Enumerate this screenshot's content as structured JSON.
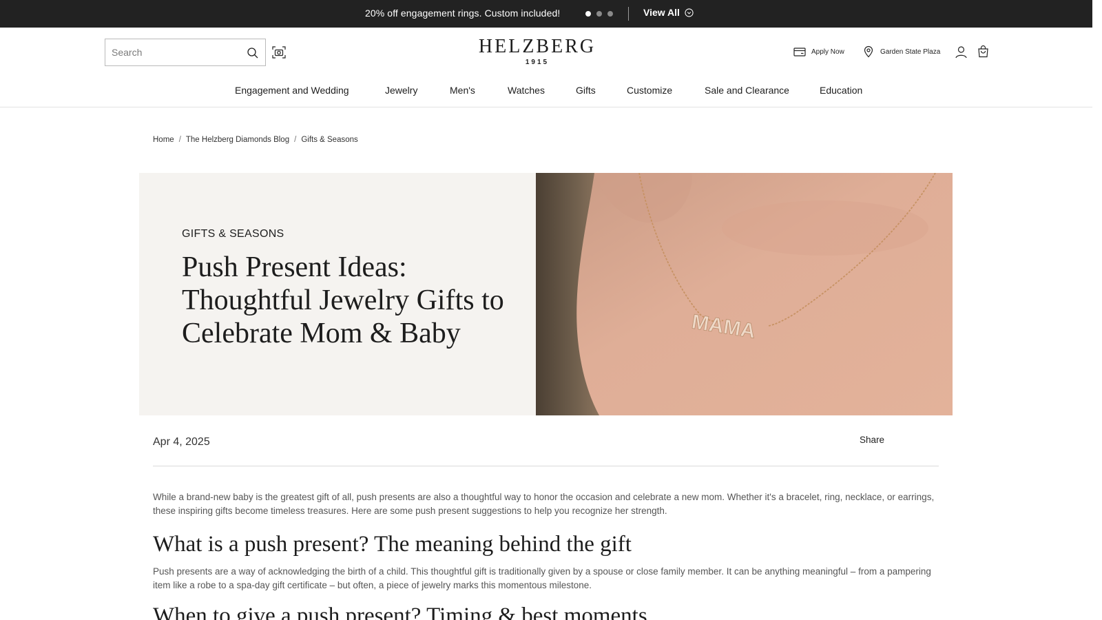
{
  "promo": {
    "text": "20% off engagement rings. Custom included!",
    "dots": [
      true,
      false,
      false
    ],
    "view_all_label": "View All"
  },
  "header": {
    "search_placeholder": "Search",
    "logo_name": "HELZBERG",
    "logo_year": "1915",
    "apply_label": "Apply Now",
    "store_label": "Garden State Plaza"
  },
  "nav": {
    "items": [
      "Engagement and Wedding",
      "Jewelry",
      "Men's",
      "Watches",
      "Gifts",
      "Customize",
      "Sale and Clearance",
      "Education"
    ]
  },
  "breadcrumb": {
    "items": [
      "Home",
      "The Helzberg Diamonds Blog",
      "Gifts & Seasons"
    ],
    "separator": "/"
  },
  "hero": {
    "category": "GIFTS & SEASONS",
    "title": "Push Present Ideas: Thoughtful Jewelry Gifts to Celebrate Mom & Baby",
    "image_text": "MAMA"
  },
  "article": {
    "date": "Apr 4, 2025",
    "share_label": "Share",
    "intro": "While a brand-new baby is the greatest gift of all, push presents are also a thoughtful way to honor the occasion and celebrate a new mom. Whether it's a bracelet, ring, necklace, or earrings, these inspiring gifts become timeless treasures. Here are some push present suggestions to help you recognize her strength.",
    "heading_1": "What is a push present? The meaning behind the gift",
    "para_1": "Push presents are a way of acknowledging the birth of a child. This thoughtful gift is traditionally given by a spouse or close family member. It can be anything meaningful – from a pampering item like a robe to a spa-day gift certificate – but often, a piece of jewelry marks this momentous milestone.",
    "heading_2": "When to give a push present? Timing & best moments"
  },
  "colors": {
    "promo_bg": "#222222",
    "hero_panel_bg": "#f5f3f0",
    "text_primary": "#1d1d1d",
    "text_body": "#555555"
  }
}
